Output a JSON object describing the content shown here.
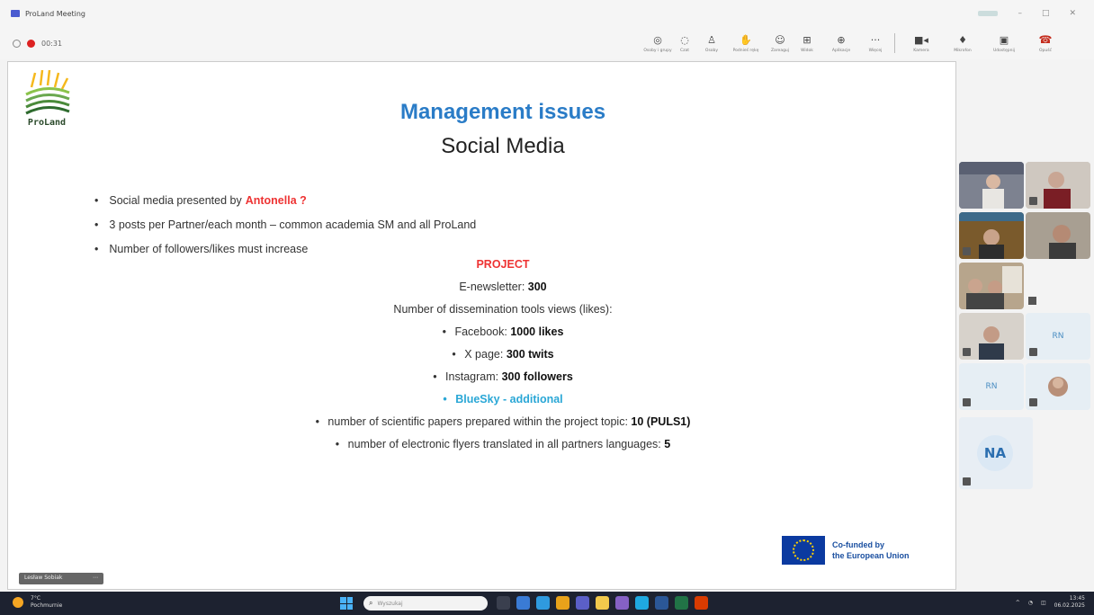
{
  "window": {
    "title": "ProLand Meeting"
  },
  "toolbar": {
    "recording_text": "00:31",
    "tools": [
      {
        "icon": "people-icon",
        "label": "Osoby i grupy"
      },
      {
        "icon": "chat-icon",
        "label": "Czat"
      },
      {
        "icon": "participants-icon",
        "label": "Osoby"
      },
      {
        "icon": "raise-hand-icon",
        "label": "Podnieś rękę"
      },
      {
        "icon": "reactions-icon",
        "label": "Zareaguj"
      },
      {
        "icon": "view-icon",
        "label": "Widok"
      },
      {
        "icon": "rooms-icon",
        "label": "Aplikacje"
      },
      {
        "icon": "more-icon",
        "label": "Więcej"
      }
    ],
    "camera_label": "Kamera",
    "mic_label": "Mikrofon",
    "share_label": "Udostępnij",
    "leave_label": "Opuść"
  },
  "slide": {
    "logo_text": "ProLand",
    "title": "Management issues",
    "subtitle": "Social Media",
    "bullets": {
      "b1_text": "Social media presented by",
      "b1_name": "Antonella  ?",
      "b2": "3 posts per Partner/each month – common academia SM and all ProLand",
      "b3": "Number of followers/likes must increase"
    },
    "project": {
      "heading": "PROJECT",
      "newsletter_label": "E-newsletter:",
      "newsletter_value": "300",
      "views_label": "Number of dissemination tools views (likes):",
      "facebook_label": "Facebook:",
      "facebook_value": "1000 likes",
      "x_label": "X page:",
      "x_value": "300 twits",
      "instagram_label": "Instagram:",
      "instagram_value": "300 followers",
      "bluesky": "BlueSky - additional",
      "papers_label": "number of scientific papers prepared within the project topic:",
      "papers_value": "10 (PULS1)",
      "flyers_label": "number of electronic flyers translated in all partners languages:",
      "flyers_value": "5"
    },
    "eu_line1": "Co-funded by",
    "eu_line2": "the European Union",
    "speaker_tag": "Lesław Sobiak"
  },
  "participants": {
    "rn1": "RN",
    "rn2": "RN",
    "na": "NA"
  },
  "taskbar": {
    "weather_temp": "7°C",
    "weather_desc": "Pochmurnie",
    "search_placeholder": "Wyszukaj",
    "time": "13:45",
    "date": "06.02.2025"
  }
}
